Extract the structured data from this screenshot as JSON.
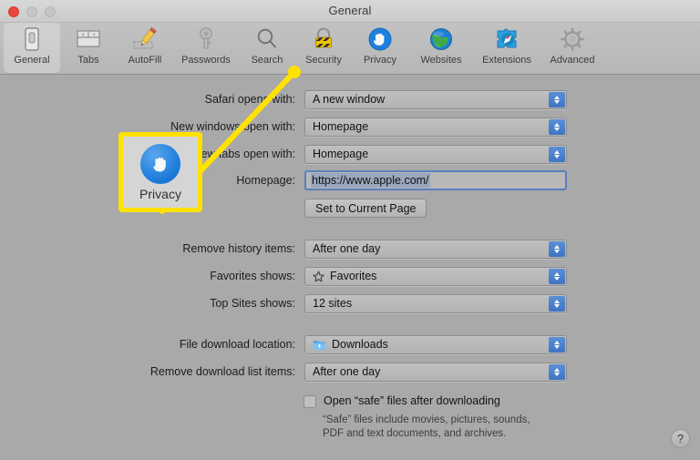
{
  "window": {
    "title": "General",
    "traffic_lights": [
      "close",
      "minimize",
      "zoom"
    ]
  },
  "toolbar": {
    "items": [
      {
        "label": "General",
        "icon": "general-icon",
        "selected": true
      },
      {
        "label": "Tabs",
        "icon": "tabs-icon",
        "selected": false
      },
      {
        "label": "AutoFill",
        "icon": "autofill-icon",
        "selected": false
      },
      {
        "label": "Passwords",
        "icon": "passwords-icon",
        "selected": false
      },
      {
        "label": "Search",
        "icon": "search-icon",
        "selected": false
      },
      {
        "label": "Security",
        "icon": "security-icon",
        "selected": false
      },
      {
        "label": "Privacy",
        "icon": "privacy-icon",
        "selected": false
      },
      {
        "label": "Websites",
        "icon": "websites-icon",
        "selected": false
      },
      {
        "label": "Extensions",
        "icon": "extensions-icon",
        "selected": false
      },
      {
        "label": "Advanced",
        "icon": "advanced-icon",
        "selected": false
      }
    ]
  },
  "general": {
    "safari_opens_with": {
      "label": "Safari opens with:",
      "value": "A new window"
    },
    "new_windows_open_with": {
      "label": "New windows open with:",
      "value": "Homepage"
    },
    "new_tabs_open_with": {
      "label": "New tabs open with:",
      "value": "Homepage"
    },
    "homepage": {
      "label": "Homepage:",
      "value": "https://www.apple.com/"
    },
    "set_to_current_page": "Set to Current Page",
    "remove_history_items": {
      "label": "Remove history items:",
      "value": "After one day"
    },
    "favorites_shows": {
      "label": "Favorites shows:",
      "value": "Favorites",
      "icon": "star-icon"
    },
    "top_sites_shows": {
      "label": "Top Sites shows:",
      "value": "12 sites"
    },
    "file_download_location": {
      "label": "File download location:",
      "value": "Downloads",
      "icon": "downloads-folder-icon"
    },
    "remove_download_list_items": {
      "label": "Remove download list items:",
      "value": "After one day"
    },
    "open_safe_files": {
      "label": "Open “safe” files after downloading",
      "checked": false,
      "help": "“Safe” files include movies, pictures, sounds, PDF and text documents, and archives."
    },
    "help_button": "?"
  },
  "callout": {
    "label": "Privacy",
    "icon": "privacy-hand-icon",
    "highlight_color": "#ffe200",
    "target": "Privacy toolbar item"
  },
  "colors": {
    "accent_blue": "#3f74c4",
    "highlight_yellow": "#ffe200",
    "window_background": "#a9a9a9",
    "toolbar_background": "#bcbcbc"
  }
}
